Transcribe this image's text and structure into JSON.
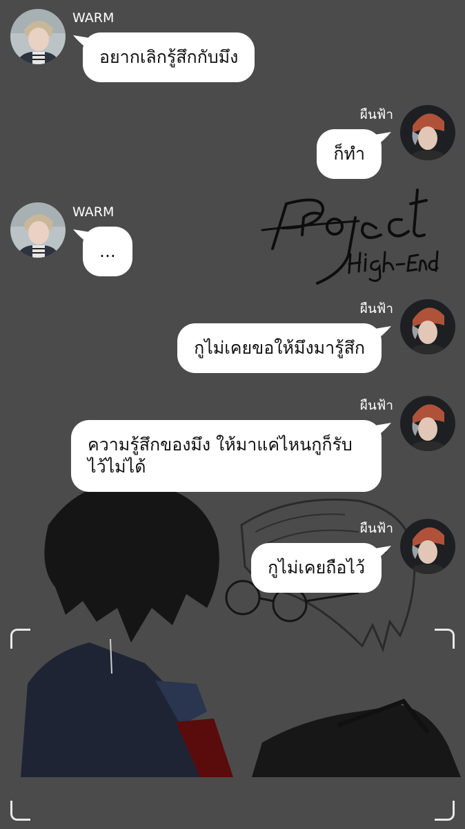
{
  "chat": {
    "messages": [
      {
        "sender": "WARM",
        "side": "left",
        "text": "อยากเลิกรู้สึกกับมึง"
      },
      {
        "sender": "ผืนฟ้า",
        "side": "right",
        "text": "ก็ทำ"
      },
      {
        "sender": "WARM",
        "side": "left",
        "text": "..."
      },
      {
        "sender": "ผืนฟ้า",
        "side": "right",
        "text": "กูไม่เคยขอให้มึงมารู้สึก"
      },
      {
        "sender": "ผืนฟ้า",
        "side": "right",
        "text": "ความรู้สึกของมึง ให้มาแค่ไหนกูก็รับไว้ไม่ได้"
      },
      {
        "sender": "ผืนฟ้า",
        "side": "right",
        "text": "กูไม่เคยถือไว้"
      }
    ]
  },
  "artwork": {
    "logo_text": "Project High-End",
    "icon": "project-high-end-logo"
  },
  "colors": {
    "background": "#4b4b4b",
    "bubble": "#ffffff",
    "text": "#111111",
    "name_text": "#ffffff"
  }
}
